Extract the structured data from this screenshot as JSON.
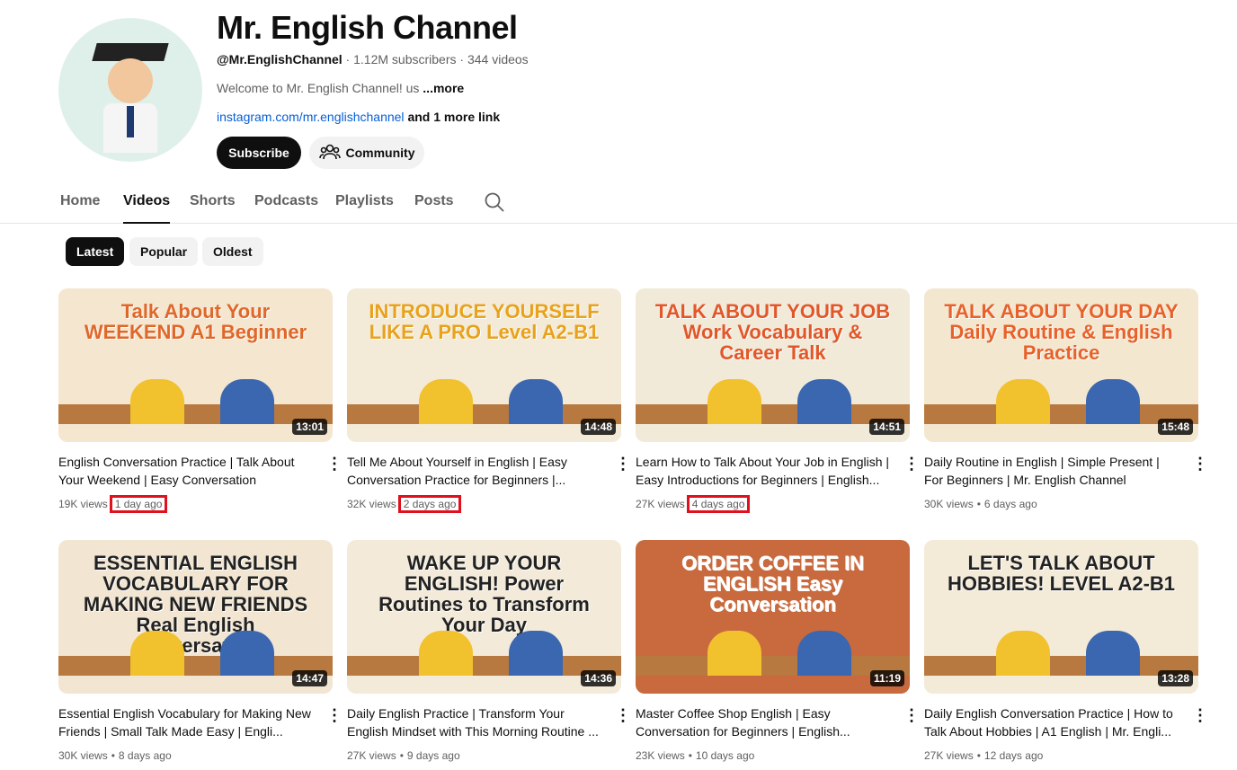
{
  "channel": {
    "name": "Mr. English Channel",
    "handle": "@Mr.EnglishChannel",
    "subscribers": "1.12M subscribers",
    "videos": "344 videos",
    "description": "Welcome to Mr. English Channel! us",
    "more": "...more",
    "link": "instagram.com/mr.englishchannel",
    "more_links": "and 1 more link",
    "subscribe": "Subscribe",
    "community": "Community"
  },
  "tabs": [
    "Home",
    "Videos",
    "Shorts",
    "Podcasts",
    "Playlists",
    "Posts"
  ],
  "chips": [
    "Latest",
    "Popular",
    "Oldest"
  ],
  "videos": [
    {
      "thumb": "Talk About Your WEEKEND A1 Beginner",
      "duration": "13:01",
      "title": "English Conversation Practice | Talk About Your Weekend | Easy Conversation Practice...",
      "views": "19K views",
      "when": "1 day ago",
      "bg": "#f4e6cf",
      "fg": "#e0672a"
    },
    {
      "thumb": "INTRODUCE YOURSELF LIKE A PRO Level A2-B1",
      "duration": "14:48",
      "title": "Tell Me About Yourself in English | Easy Conversation Practice for Beginners |...",
      "views": "32K views",
      "when": "2 days ago",
      "bg": "#f3ead8",
      "fg": "#e8a21b"
    },
    {
      "thumb": "TALK ABOUT YOUR JOB Work Vocabulary & Career Talk",
      "duration": "14:51",
      "title": "Learn How to Talk About Your Job in English | Easy Introductions for Beginners | English...",
      "views": "27K views",
      "when": "4 days ago",
      "bg": "#f1ead9",
      "fg": "#e2572a"
    },
    {
      "thumb": "TALK ABOUT YOUR DAY Daily Routine & English Practice",
      "duration": "15:48",
      "title": "Daily Routine in English | Simple Present | For Beginners | Mr. English Channel",
      "views": "30K views",
      "when": "6 days ago",
      "bg": "#f3e7d0",
      "fg": "#e8612a"
    },
    {
      "thumb": "ESSENTIAL ENGLISH VOCABULARY FOR MAKING NEW FRIENDS Real English Conversation",
      "duration": "14:47",
      "title": "Essential English Vocabulary for Making New Friends | Small Talk Made Easy | Engli...",
      "views": "30K views",
      "when": "8 days ago",
      "bg": "#f2e6d2",
      "fg": "#222222"
    },
    {
      "thumb": "WAKE UP YOUR ENGLISH! Power Routines to Transform Your Day",
      "duration": "14:36",
      "title": "Daily English Practice | Transform Your English Mindset with This Morning Routine ...",
      "views": "27K views",
      "when": "9 days ago",
      "bg": "#f3ead9",
      "fg": "#222222"
    },
    {
      "thumb": "ORDER COFFEE IN ENGLISH Easy Conversation",
      "duration": "11:19",
      "title": "Master Coffee Shop English | Easy Conversation for Beginners | English...",
      "views": "23K views",
      "when": "10 days ago",
      "bg": "#c86a3e",
      "fg": "#ffffff"
    },
    {
      "thumb": "LET'S TALK ABOUT HOBBIES! LEVEL A2-B1",
      "duration": "13:28",
      "title": "Daily English Conversation Practice | How to Talk About Hobbies | A1 English | Mr. Engli...",
      "views": "27K views",
      "when": "12 days ago",
      "bg": "#f4ead8",
      "fg": "#222222"
    }
  ]
}
